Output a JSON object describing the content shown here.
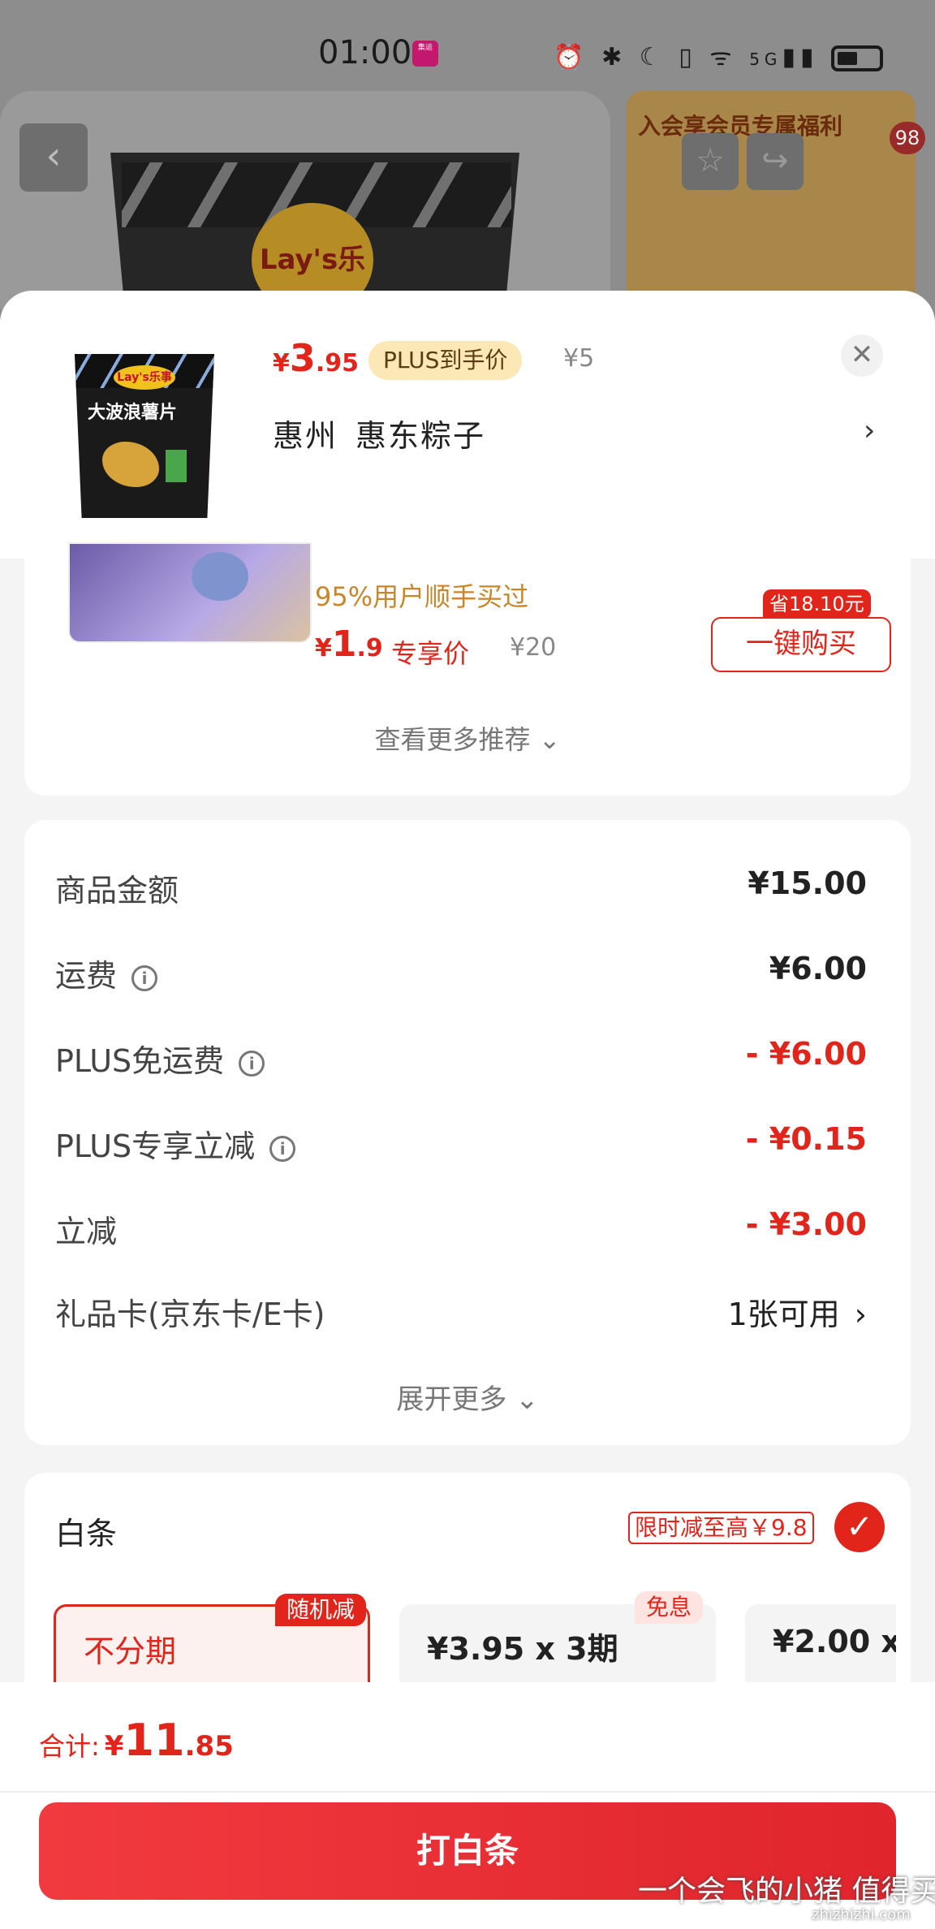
{
  "status_bar": {
    "time": "01:00",
    "badge": "集运",
    "network": "5G"
  },
  "background": {
    "back_icon": "chevron-left-icon",
    "brand_logo": "Lay's乐事",
    "promo_title": "入会享会员专属福利",
    "cart_count": "98"
  },
  "product": {
    "thumb_brand": "Lay's乐事",
    "thumb_name": "大波浪薯片",
    "price_currency": "¥",
    "price_int": "3",
    "price_dec": ".95",
    "plus_tag": "PLUS到手价",
    "original_price": "¥5",
    "address_city": "惠州",
    "address_detail": "惠东粽子"
  },
  "recommendation": {
    "hint": "95%用户顺手买过",
    "price_currency": "¥",
    "price_int": "1",
    "price_dec": ".9",
    "price_tag": "专享价",
    "original_price": "¥20",
    "save_badge": "省18.10元",
    "buy_label": "一键购买",
    "more_label": "查看更多推荐"
  },
  "amounts": {
    "rows": [
      {
        "label": "商品金额",
        "value": "¥15.00"
      },
      {
        "label": "运费",
        "value": "¥6.00"
      },
      {
        "label": "PLUS免运费",
        "value": "- ¥6.00"
      },
      {
        "label": "PLUS专享立减",
        "value": "- ¥0.15"
      },
      {
        "label": "立减",
        "value": "- ¥3.00"
      },
      {
        "label": "礼品卡(京东卡/E卡)",
        "value": "1张可用"
      }
    ],
    "expand_label": "展开更多"
  },
  "baitiao": {
    "title": "白条",
    "promo": "限时减至高￥9.8",
    "options": [
      {
        "label": "不分期",
        "badge": "随机减"
      },
      {
        "label": "¥3.95 x 3期",
        "badge": "免息"
      },
      {
        "label": "¥2.00 x"
      }
    ]
  },
  "footer": {
    "total_label": "合计:",
    "total_currency": "¥",
    "total_int": "11",
    "total_dec": ".85",
    "pay_label": "打白条",
    "watermark": "一个会飞的小猪  值得买",
    "watermark_sub": "zhizhizhi.com"
  },
  "colors": {
    "accent": "#e1251b",
    "plus_tag_bg": "#fce7b6",
    "hint": "#c8862a"
  }
}
